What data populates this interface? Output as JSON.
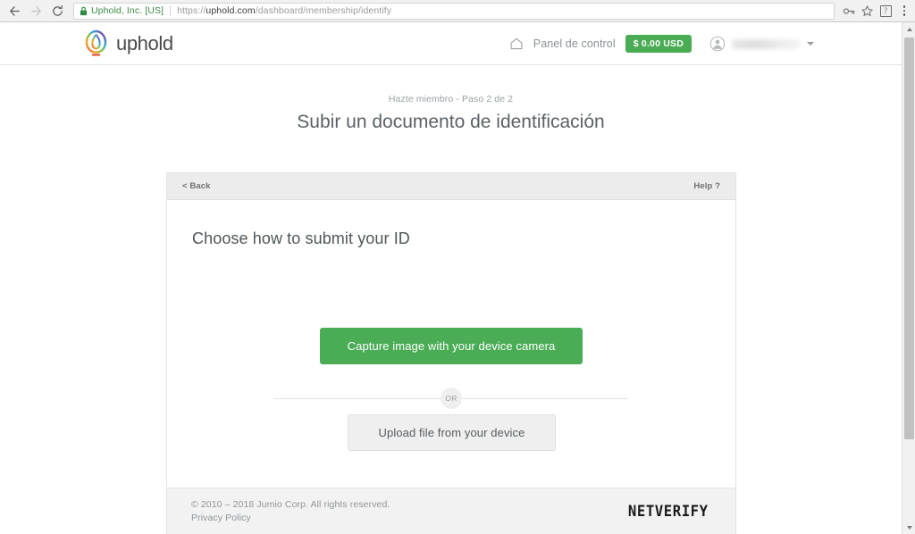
{
  "browser": {
    "back_icon": "arrow-left-icon",
    "forward_icon": "arrow-right-icon",
    "reload_icon": "reload-icon",
    "lock_icon": "lock-icon",
    "site_identity": "Uphold, Inc. [US]",
    "url_scheme": "https://",
    "url_host": "uphold.com",
    "url_path": "/dashboard/membership/identify",
    "key_icon": "key-icon",
    "star_icon": "star-icon",
    "extension_icon": "extension-puzzle-icon",
    "menu_icon": "three-dot-menu-icon"
  },
  "header": {
    "logo_name": "uphold-logo-icon",
    "brand": "uphold",
    "home_icon": "home-icon",
    "dashboard_label": "Panel de control",
    "balance": "$ 0.00 USD",
    "balance_color": "#4aab55",
    "avatar_icon": "user-avatar-icon",
    "username": "",
    "caret_icon": "chevron-down-icon"
  },
  "page": {
    "step_label": "Hazte miembro - Paso 2 de 2",
    "title": "Subir un documento de identificación"
  },
  "card": {
    "back_label": "< Back",
    "help_label": "Help ?",
    "heading": "Choose how to submit your ID",
    "capture_button": "Capture image with your device camera",
    "capture_color": "#4aad56",
    "or_label": "OR",
    "upload_button": "Upload file from your device",
    "footer": {
      "copyright": "© 2010 – 2018 Jumio Corp. All rights reserved.",
      "privacy_link": "Privacy Policy",
      "brand": "NETVERIFY"
    }
  },
  "scrollbar": {
    "up_icon": "scroll-up-arrow-icon",
    "down_icon": "scroll-down-arrow-icon"
  }
}
